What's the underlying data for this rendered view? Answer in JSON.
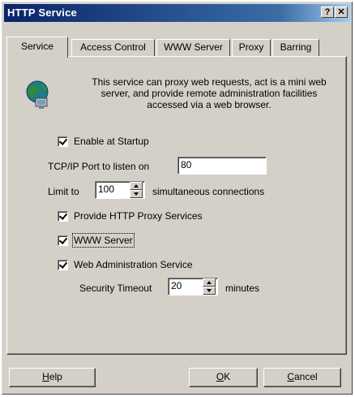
{
  "window": {
    "title": "HTTP Service",
    "help_button": "?",
    "close_button": "✕"
  },
  "tabs": [
    {
      "label": "Service",
      "active": true
    },
    {
      "label": "Access Control",
      "active": false
    },
    {
      "label": "WWW Server",
      "active": false
    },
    {
      "label": "Proxy",
      "active": false
    },
    {
      "label": "Barring",
      "active": false
    }
  ],
  "service": {
    "icon": "globe-network-icon",
    "description": "This service can proxy web requests, act is a mini web server, and provide remote administration facilities accessed via a web browser.",
    "enable_at_startup": {
      "label": "Enable at Startup",
      "checked": true
    },
    "port": {
      "label": "TCP/IP Port to listen on",
      "value": "80"
    },
    "limit": {
      "label_before": "Limit to",
      "value": "100",
      "label_after": "simultaneous connections"
    },
    "http_proxy": {
      "label": "Provide HTTP Proxy Services",
      "checked": true
    },
    "www_server": {
      "label": "WWW Server",
      "checked": true
    },
    "web_admin": {
      "label": "Web Administration Service",
      "checked": true
    },
    "timeout": {
      "label_before": "Security Timeout",
      "value": "20",
      "label_after": "minutes"
    }
  },
  "buttons": {
    "help": {
      "mnemonic": "H",
      "rest": "elp"
    },
    "ok": {
      "mnemonic": "O",
      "rest": "K"
    },
    "cancel": {
      "mnemonic": "C",
      "rest": "ancel"
    }
  }
}
